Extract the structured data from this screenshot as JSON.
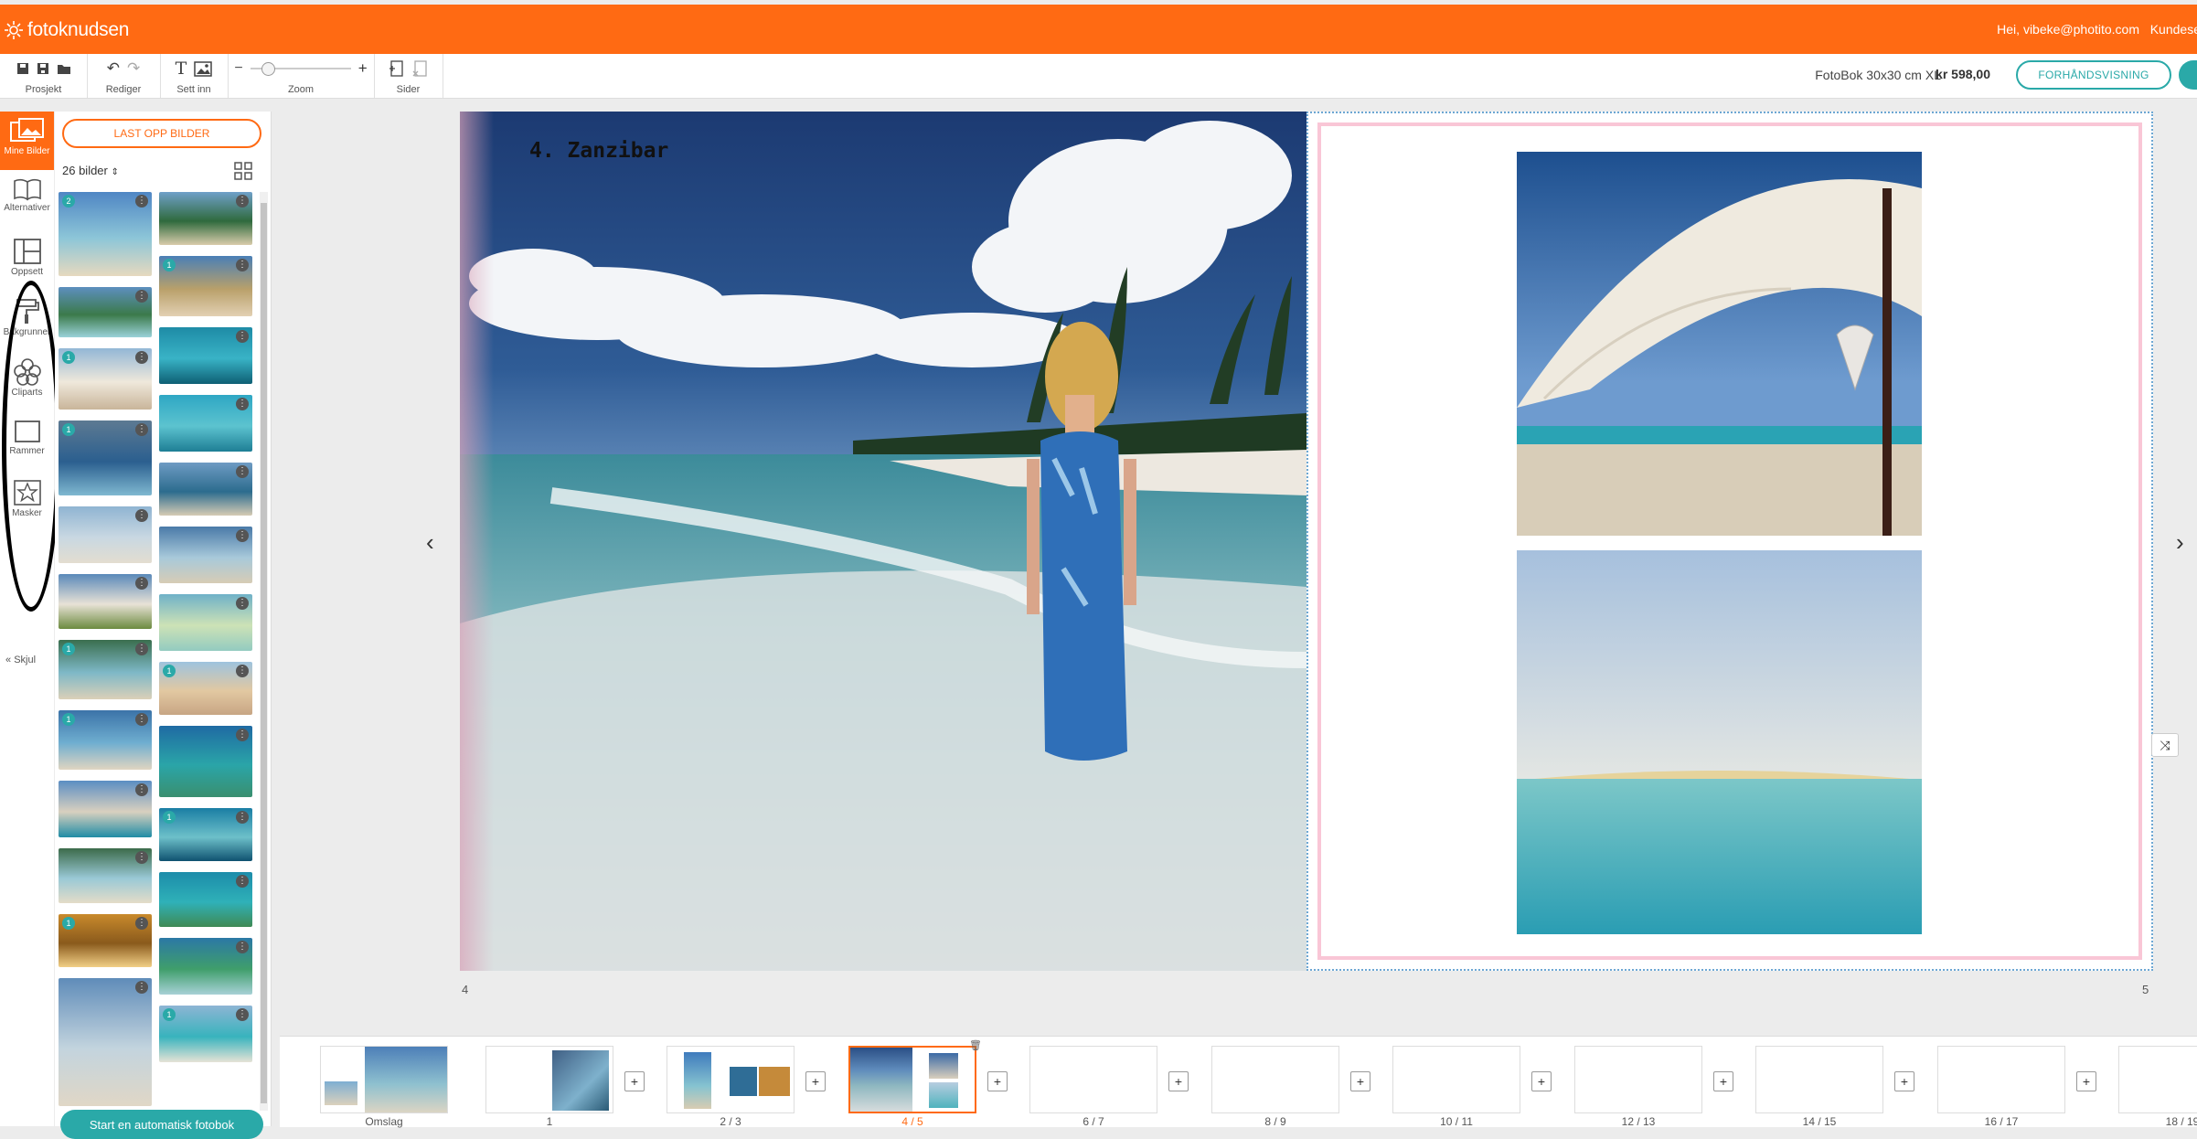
{
  "topbar": {
    "brand": "fotoknudsen",
    "greeting": "Hei, vibeke@photito.com",
    "customer_link": "Kundese"
  },
  "toolbar": {
    "groups": [
      {
        "label": "Prosjekt",
        "icons": [
          "save-icon",
          "save-as-icon",
          "folder-icon"
        ]
      },
      {
        "label": "Rediger",
        "icons": [
          "undo-icon",
          "redo-icon"
        ]
      },
      {
        "label": "Sett inn",
        "icons": [
          "text-icon",
          "image-icon"
        ]
      },
      {
        "label": "Zoom",
        "minus": "−",
        "plus": "+"
      },
      {
        "label": "Sider",
        "icons": [
          "add-page-icon",
          "delete-page-icon"
        ]
      }
    ],
    "product": "FotoBok 30x30 cm XL",
    "price": "kr 598,00",
    "preview_label": "FORHÅNDSVISNING"
  },
  "sidebar": {
    "items": [
      {
        "label": "Mine Bilder",
        "icon": "photos-icon"
      },
      {
        "label": "Alternativer",
        "icon": "book-icon"
      },
      {
        "label": "Oppsett",
        "icon": "layout-icon"
      },
      {
        "label": "Bakgrunner",
        "icon": "paint-roller-icon"
      },
      {
        "label": "Cliparts",
        "icon": "flower-icon"
      },
      {
        "label": "Rammer",
        "icon": "frame-icon"
      },
      {
        "label": "Masker",
        "icon": "star-icon"
      }
    ],
    "hide_label": "Skjul"
  },
  "panel": {
    "upload_label": "LAST OPP BILDER",
    "count_label": "26 bilder",
    "auto_label": "Start en automatisk fotobok",
    "thumbs": [
      {
        "badge": "2"
      },
      {
        "badge": ""
      },
      {
        "badge": ""
      },
      {
        "badge": "1"
      },
      {
        "badge": "1"
      },
      {
        "badge": ""
      },
      {
        "badge": "1"
      },
      {
        "badge": ""
      },
      {
        "badge": ""
      },
      {
        "badge": ""
      },
      {
        "badge": ""
      },
      {
        "badge": ""
      },
      {
        "badge": "1"
      },
      {
        "badge": ""
      },
      {
        "badge": "1"
      },
      {
        "badge": "1"
      },
      {
        "badge": ""
      },
      {
        "badge": ""
      },
      {
        "badge": ""
      },
      {
        "badge": "1"
      },
      {
        "badge": "1"
      },
      {
        "badge": ""
      },
      {
        "badge": ""
      },
      {
        "badge": ""
      },
      {
        "badge": ""
      },
      {
        "badge": "1"
      }
    ]
  },
  "spread": {
    "title": "4. Zanzibar",
    "left_page_number": "4",
    "right_page_number": "5"
  },
  "filmstrip": {
    "pages": [
      {
        "label": "Omslag"
      },
      {
        "label": "1"
      },
      {
        "label": "2 / 3"
      },
      {
        "label": "4 / 5",
        "active": true
      },
      {
        "label": "6 / 7"
      },
      {
        "label": "8 / 9"
      },
      {
        "label": "10 / 11"
      },
      {
        "label": "12 / 13"
      },
      {
        "label": "14 / 15"
      },
      {
        "label": "16 / 17"
      },
      {
        "label": "18 / 19"
      }
    ],
    "add_symbol": "+"
  },
  "colors": {
    "brand": "#ff6a13",
    "accent": "#2aa9a8",
    "frame": "#f9c6d6"
  }
}
